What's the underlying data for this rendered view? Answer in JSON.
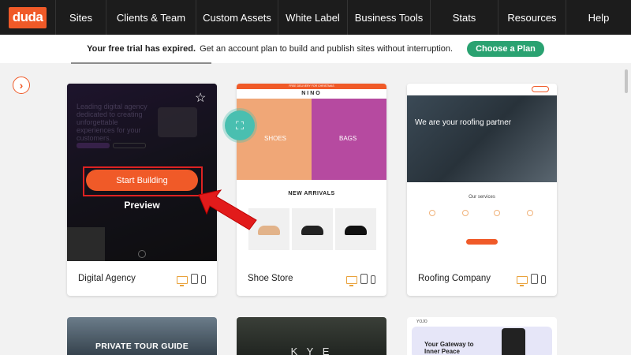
{
  "nav": {
    "logo": "duda",
    "items": [
      "Sites",
      "Clients & Team",
      "Custom Assets",
      "White Label",
      "Business Tools",
      "Stats",
      "Resources",
      "Help"
    ]
  },
  "banner": {
    "bold": "Your free trial has expired.",
    "text": "Get an account plan to build and publish sites without interruption.",
    "button": "Choose a Plan"
  },
  "templates": [
    {
      "name": "Digital Agency",
      "hero_text": "Leading digital agency dedicated to creating unforgettable experiences for your customers.",
      "start_label": "Start Building",
      "preview_label": "Preview"
    },
    {
      "name": "Shoe Store",
      "brand": "NINO",
      "promo": "FREE DELIVERY FOR CHRISTMAS",
      "shoes_label": "SHOES",
      "bags_label": "BAGS",
      "arrivals": "NEW ARRIVALS"
    },
    {
      "name": "Roofing Company",
      "headline": "We are your roofing partner",
      "services": "Our services"
    }
  ],
  "row2": [
    {
      "label": "PRIVATE TOUR GUIDE"
    },
    {
      "label": "K Y E"
    },
    {
      "brand": "YOJO",
      "label": "Your Gateway to Inner Peace"
    }
  ],
  "colors": {
    "accent": "#f05a28",
    "green": "#2aa271",
    "nav_bg": "#1c1c1c"
  }
}
